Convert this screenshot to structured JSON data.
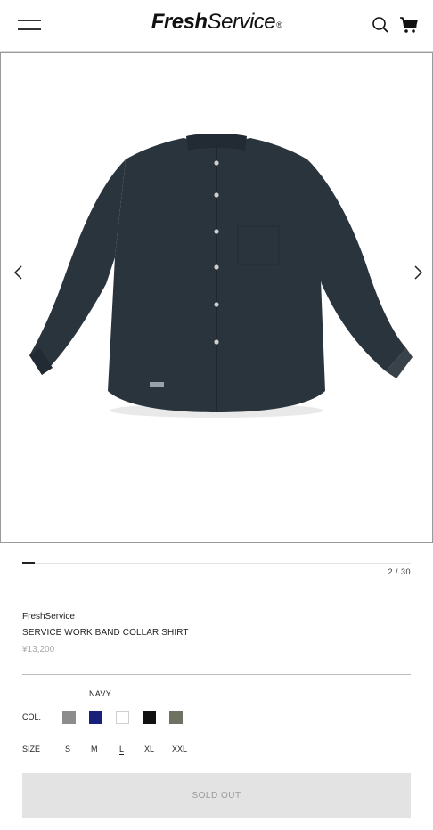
{
  "header": {
    "logo_bold": "Fresh",
    "logo_rest": "Service",
    "logo_mark": "®",
    "icons": [
      "menu-icon",
      "search-icon",
      "cart-icon"
    ]
  },
  "gallery": {
    "current": "2",
    "separator": " / ",
    "total": "30",
    "progress": 0.033,
    "shirt_color": "#2a343d",
    "icons": [
      "chevron-left-icon",
      "chevron-right-icon"
    ]
  },
  "product": {
    "brand": "FreshService",
    "name": "SERVICE WORK BAND COLLAR SHIRT",
    "price": "¥13,200"
  },
  "color": {
    "label": "COL.",
    "selected_name": "NAVY",
    "swatches": [
      {
        "name": "gray",
        "hex": "#8c8c8c"
      },
      {
        "name": "navy",
        "hex": "#1a1f7a"
      },
      {
        "name": "white",
        "hex": "#ffffff"
      },
      {
        "name": "black",
        "hex": "#111111"
      },
      {
        "name": "olive",
        "hex": "#6e7262"
      }
    ]
  },
  "size": {
    "label": "SIZE",
    "options": [
      "S",
      "M",
      "L",
      "XL",
      "XXL"
    ],
    "selected": "L"
  },
  "cta": {
    "label": "SOLD OUT",
    "background": "#e3e3e3"
  }
}
